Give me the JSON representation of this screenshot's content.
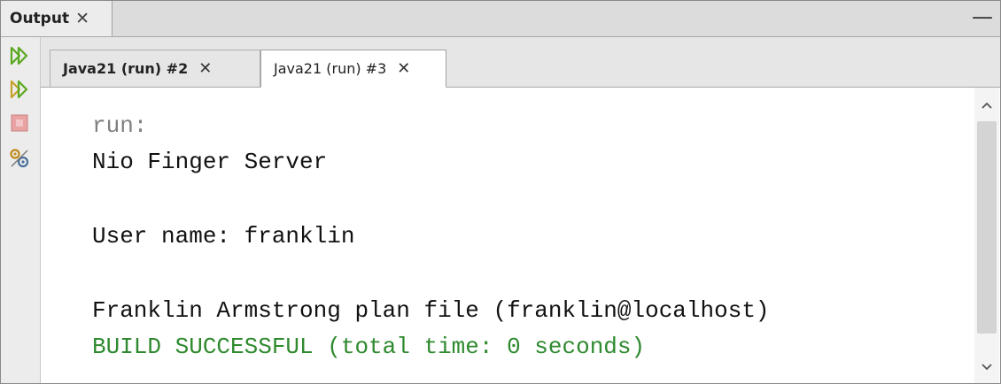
{
  "panel": {
    "title": "Output",
    "close_glyph": "✕",
    "minimize_glyph": "—"
  },
  "toolbar": {
    "icons": [
      "rerun-icon",
      "rerun-different-icon",
      "stop-icon",
      "settings-icon"
    ]
  },
  "tabs": [
    {
      "label": "Java21 (run) #2",
      "close_glyph": "✕",
      "active": false
    },
    {
      "label": "Java21 (run) #3",
      "close_glyph": "✕",
      "active": true
    }
  ],
  "console": {
    "lines": [
      {
        "text": "run:",
        "style": "gray"
      },
      {
        "text": "Nio Finger Server",
        "style": "normal"
      },
      {
        "text": "",
        "style": "normal"
      },
      {
        "text": "User name: franklin",
        "style": "normal"
      },
      {
        "text": "",
        "style": "normal"
      },
      {
        "text": "Franklin Armstrong plan file (franklin@localhost)",
        "style": "normal"
      },
      {
        "text": "BUILD SUCCESSFUL (total time: 0 seconds)",
        "style": "green"
      }
    ]
  },
  "colors": {
    "build_success": "#2f8a2f",
    "run_label": "#808080",
    "rerun_icon": "#5aa81e",
    "stop_icon": "#e38a8a"
  }
}
